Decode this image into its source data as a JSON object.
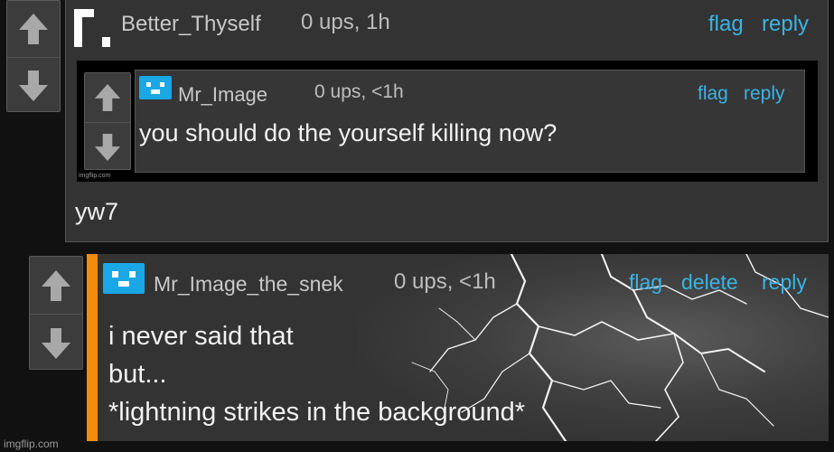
{
  "comment1": {
    "username": "Better_Thyself",
    "meta": "0 ups, 1h",
    "actions": {
      "flag": "flag",
      "reply": "reply"
    },
    "body": "yw7",
    "embedded_image": {
      "username": "Mr_Image",
      "meta": "0 ups, <1h",
      "actions": {
        "flag": "flag",
        "reply": "reply"
      },
      "body": "you should do the yourself killing now?",
      "watermark": "imgflip.com"
    }
  },
  "comment2": {
    "username": "Mr_Image_the_snek",
    "meta": "0 ups, <1h",
    "actions": {
      "flag": "flag",
      "delete": "delete",
      "reply": "reply"
    },
    "body_lines": [
      "i never said that",
      "but...",
      "*lightning strikes in the background*"
    ]
  },
  "watermark": "imgflip.com",
  "colors": {
    "link": "#3ab3e6",
    "accent_bar": "#f28c0f",
    "avatar": "#1aa7e6"
  },
  "icons": {
    "upvote": "arrow-up",
    "downvote": "arrow-down",
    "avatar": "pixel-face"
  }
}
